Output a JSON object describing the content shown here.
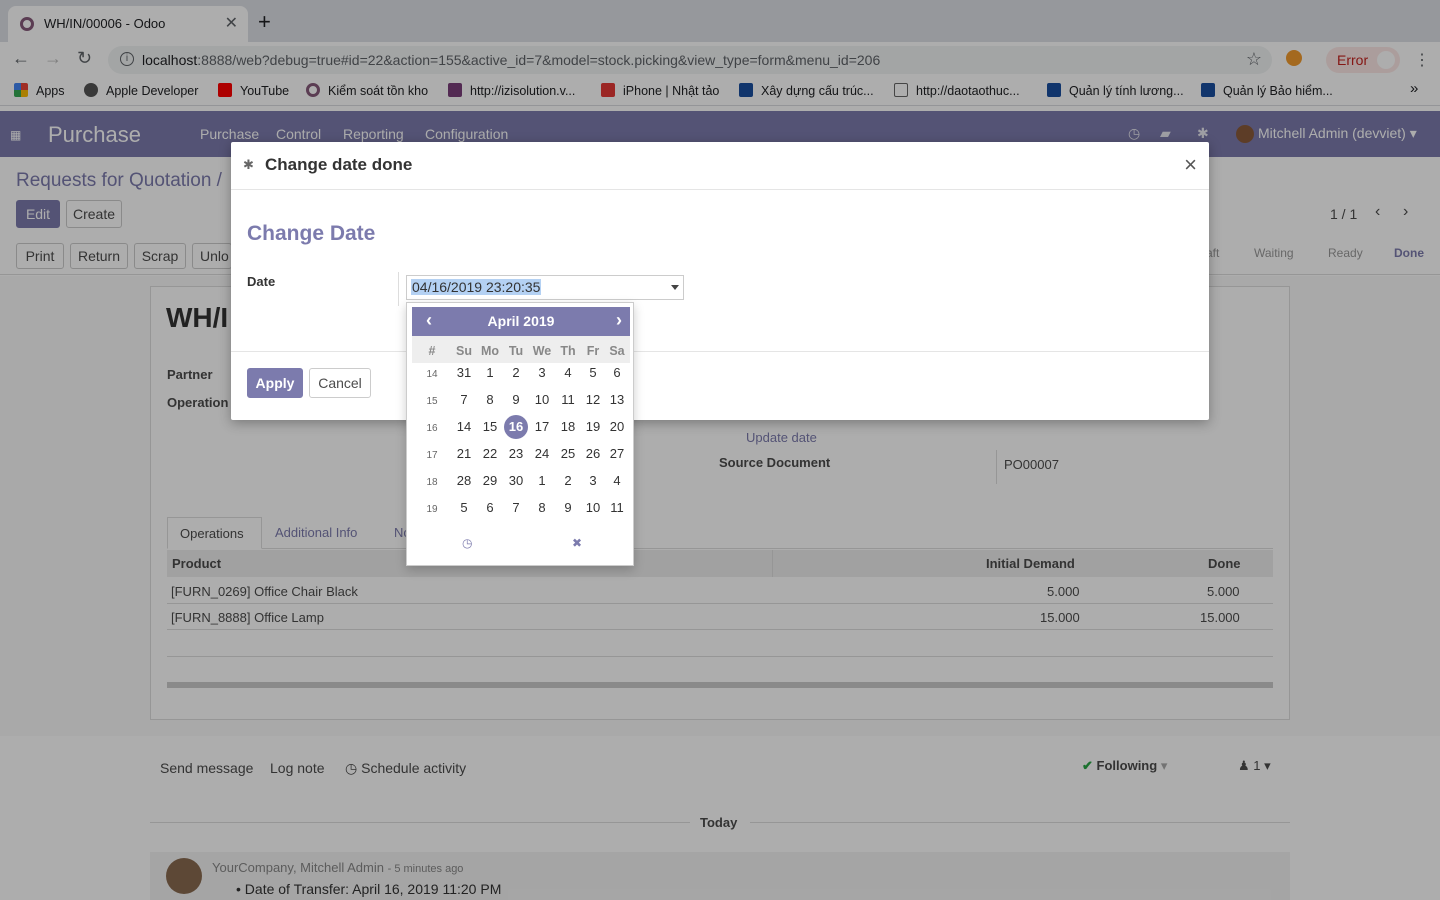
{
  "browser": {
    "tab_title": "WH/IN/00006 - Odoo",
    "url_host": "localhost",
    "url_rest": ":8888/web?debug=true#id=22&action=155&active_id=7&model=stock.picking&view_type=form&menu_id=206",
    "error_label": "Error",
    "bookmarks": [
      "Apps",
      "Apple Developer",
      "YouTube",
      "Kiểm soát tồn kho",
      "http://izisolution.v...",
      "iPhone | Nhật tảo",
      "Xây dựng cấu trúc...",
      "http://daotaothuc...",
      "Quản lý tính lương...",
      "Quản lý Bảo hiểm..."
    ],
    "more": "»"
  },
  "nav": {
    "brand": "Purchase",
    "menus": [
      "Purchase",
      "Control",
      "Reporting",
      "Configuration"
    ],
    "user": "Mitchell Admin (devviet)"
  },
  "control": {
    "breadcrumb": "Requests for Quotation /",
    "edit": "Edit",
    "create": "Create",
    "pager": "1 / 1",
    "actions": [
      "Print",
      "Return",
      "Scrap",
      "Unlo"
    ],
    "statuses": [
      "aft",
      "Waiting",
      "Ready",
      "Done"
    ]
  },
  "form": {
    "title": "WH/I",
    "partner_label": "Partner",
    "operation_label": "Operation",
    "update_date": "Update date",
    "source_label": "Source Document",
    "source_value": "PO00007",
    "tabs": [
      "Operations",
      "Additional Info",
      "No"
    ],
    "columns": [
      "Product",
      "Initial Demand",
      "Done"
    ],
    "rows": [
      {
        "product": "[FURN_0269] Office Chair Black",
        "demand": "5.000",
        "done": "5.000"
      },
      {
        "product": "[FURN_8888] Office Lamp",
        "demand": "15.000",
        "done": "15.000"
      }
    ]
  },
  "chatter": {
    "send": "Send message",
    "log": "Log note",
    "schedule": "Schedule activity",
    "following": "Following",
    "followers": "1",
    "today": "Today",
    "author": "YourCompany, Mitchell Admin",
    "time": "- 5 minutes ago",
    "message": "Date of Transfer: April 16, 2019 11:20 PM"
  },
  "modal": {
    "header": "Change date done",
    "title": "Change Date",
    "date_label": "Date",
    "date_value": "04/16/2019 23:20:35",
    "apply": "Apply",
    "cancel": "Cancel"
  },
  "calendar": {
    "month": "April 2019",
    "dow": [
      "#",
      "Su",
      "Mo",
      "Tu",
      "We",
      "Th",
      "Fr",
      "Sa"
    ],
    "selected": "16",
    "weeks": [
      [
        "14",
        "31",
        "1",
        "2",
        "3",
        "4",
        "5",
        "6"
      ],
      [
        "15",
        "7",
        "8",
        "9",
        "10",
        "11",
        "12",
        "13"
      ],
      [
        "16",
        "14",
        "15",
        "16",
        "17",
        "18",
        "19",
        "20"
      ],
      [
        "17",
        "21",
        "22",
        "23",
        "24",
        "25",
        "26",
        "27"
      ],
      [
        "18",
        "28",
        "29",
        "30",
        "1",
        "2",
        "3",
        "4"
      ],
      [
        "19",
        "5",
        "6",
        "7",
        "8",
        "9",
        "10",
        "11"
      ]
    ]
  },
  "colors": {
    "primary": "#7c7bad",
    "selection": "#b4d1f3"
  }
}
